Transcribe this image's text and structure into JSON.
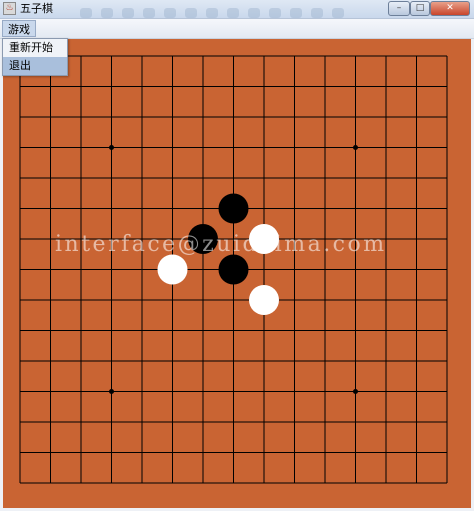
{
  "window": {
    "title": "五子棋",
    "icon": "app-java-icon",
    "controls": [
      "minimize-icon",
      "maximize-icon",
      "close-icon"
    ]
  },
  "menubar": {
    "menus": [
      {
        "label": "游戏",
        "open": true,
        "items": [
          {
            "label": "重新开始",
            "highlighted": false
          },
          {
            "label": "退出",
            "highlighted": true
          }
        ]
      }
    ]
  },
  "board": {
    "size": 15,
    "colors": {
      "wood": "#c96433",
      "line": "#000000",
      "black_stone": "#000000",
      "white_stone": "#ffffff"
    },
    "star_points": [
      [
        3,
        3
      ],
      [
        11,
        3
      ],
      [
        3,
        11
      ],
      [
        11,
        11
      ]
    ],
    "stones": [
      {
        "color": "black",
        "col": 7,
        "row": 5
      },
      {
        "color": "black",
        "col": 6,
        "row": 6
      },
      {
        "color": "white",
        "col": 8,
        "row": 6
      },
      {
        "color": "black",
        "col": 7,
        "row": 7
      },
      {
        "color": "white",
        "col": 5,
        "row": 7
      },
      {
        "color": "white",
        "col": 8,
        "row": 8
      }
    ]
  },
  "watermark": "interface@zuidaima.com"
}
